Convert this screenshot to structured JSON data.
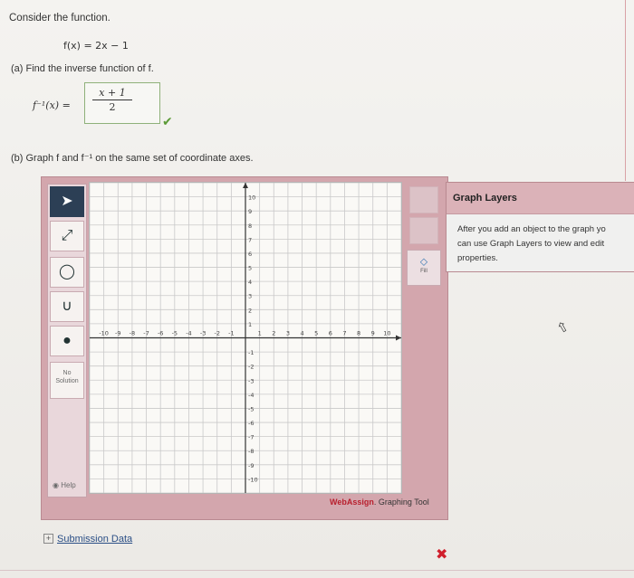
{
  "question": {
    "intro": "Consider the function.",
    "function_def": "f(x) = 2x − 1",
    "part_a": "(a)   Find the inverse function of f.",
    "inverse_label": "f⁻¹(x) =",
    "answer_numerator": "x + 1",
    "answer_denominator": "2",
    "part_b": "(b)   Graph f and f⁻¹ on the same set of coordinate axes."
  },
  "tools": {
    "no_solution_line1": "No",
    "no_solution_line2": "Solution",
    "help": "Help",
    "fill": "Fill"
  },
  "graph": {
    "x_labels": [
      "-10",
      "-9",
      "-8",
      "-7",
      "-6",
      "-5",
      "-4",
      "-3",
      "-2",
      "-1",
      "1",
      "2",
      "3",
      "4",
      "5",
      "6",
      "7",
      "8",
      "9",
      "10"
    ],
    "y_labels": [
      "10",
      "9",
      "8",
      "7",
      "6",
      "5",
      "4",
      "3",
      "2",
      "1",
      "-1",
      "-2",
      "-3",
      "-4",
      "-5",
      "-6",
      "-7",
      "-8",
      "-9",
      "-10"
    ],
    "footer_brand": "WebAssign",
    "footer_rest": ". Graphing Tool"
  },
  "layers": {
    "title": "Graph Layers",
    "line1": "After you add an object to the graph yo",
    "line2": "can use Graph Layers to view and edit",
    "line3": "properties."
  },
  "submission": {
    "label": "Submission Data"
  },
  "status": {
    "answer_a_correct": "✔",
    "answer_b_incorrect": "✖"
  },
  "colors": {
    "correct": "#5b9a37",
    "incorrect": "#d01f2c",
    "panel": "#d3a6ad"
  }
}
